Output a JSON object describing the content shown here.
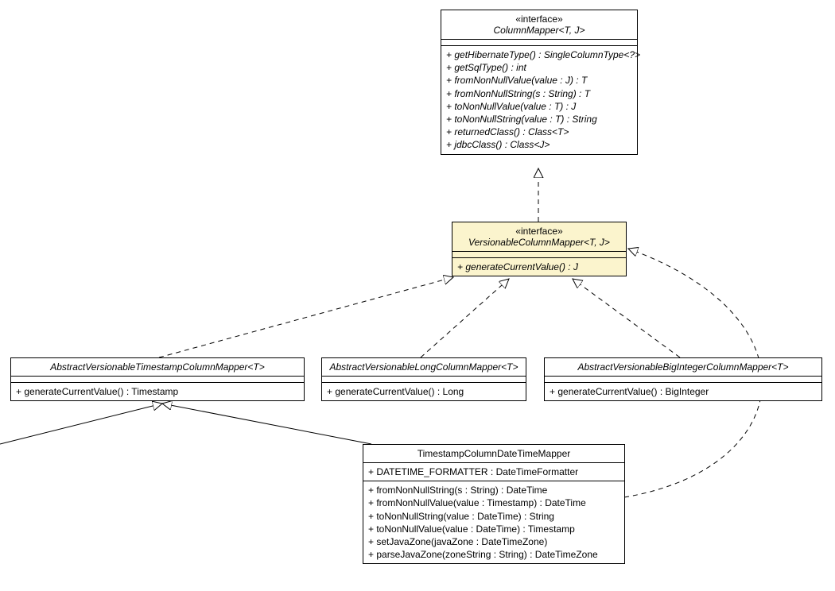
{
  "boxes": {
    "columnMapper": {
      "stereotype": "«interface»",
      "name": "ColumnMapper<T, J>",
      "methods": [
        "+ getHibernateType() : SingleColumnType<?>",
        "+ getSqlType() : int",
        "+ fromNonNullValue(value : J) : T",
        "+ fromNonNullString(s : String) : T",
        "+ toNonNullValue(value : T) : J",
        "+ toNonNullString(value : T) : String",
        "+ returnedClass() : Class<T>",
        "+ jdbcClass() : Class<J>"
      ]
    },
    "versionable": {
      "stereotype": "«interface»",
      "name": "VersionableColumnMapper<T, J>",
      "methods": [
        "+ generateCurrentValue() : J"
      ]
    },
    "ts": {
      "name": "AbstractVersionableTimestampColumnMapper<T>",
      "methods": [
        "+ generateCurrentValue() : Timestamp"
      ]
    },
    "longm": {
      "name": "AbstractVersionableLongColumnMapper<T>",
      "methods": [
        "+ generateCurrentValue() : Long"
      ]
    },
    "bigint": {
      "name": "AbstractVersionableBigIntegerColumnMapper<T>",
      "methods": [
        "+ generateCurrentValue() : BigInteger"
      ]
    },
    "datetime": {
      "name": "TimestampColumnDateTimeMapper",
      "attrs": [
        "+ DATETIME_FORMATTER : DateTimeFormatter"
      ],
      "methods": [
        "+ fromNonNullString(s : String) : DateTime",
        "+ fromNonNullValue(value : Timestamp) : DateTime",
        "+ toNonNullString(value : DateTime) : String",
        "+ toNonNullValue(value : DateTime) : Timestamp",
        "+ setJavaZone(javaZone : DateTimeZone)",
        "+ parseJavaZone(zoneString : String) : DateTimeZone"
      ]
    }
  }
}
